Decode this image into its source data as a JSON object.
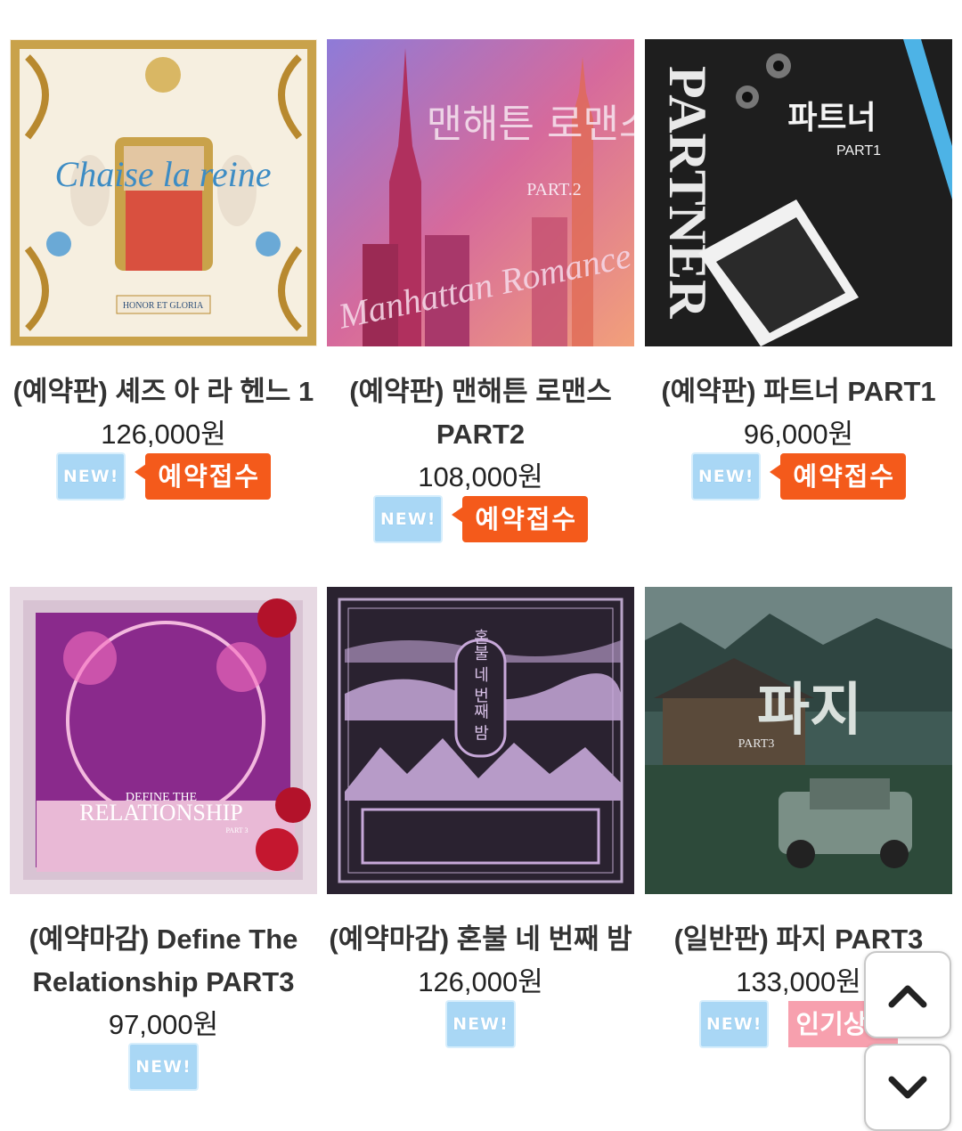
{
  "products": [
    {
      "title": "(예약판) 셰즈 아 라 헨느 1",
      "price": "126,000원",
      "badges": [
        "NEW!",
        "예약접수"
      ],
      "cover": "chaise-la-reine"
    },
    {
      "title": "(예약판) 맨해튼 로맨스 PART2",
      "price": "108,000원",
      "badges": [
        "NEW!",
        "예약접수"
      ],
      "cover": "manhattan-romance"
    },
    {
      "title": "(예약판) 파트너 PART1",
      "price": "96,000원",
      "badges": [
        "NEW!",
        "예약접수"
      ],
      "cover": "partner"
    },
    {
      "title": "(예약마감) Define The Relationship PART3",
      "price": "97,000원",
      "badges": [
        "NEW!"
      ],
      "cover": "define-relationship"
    },
    {
      "title": "(예약마감) 혼불 네 번째 밤",
      "price": "126,000원",
      "badges": [
        "NEW!"
      ],
      "cover": "honbul"
    },
    {
      "title": "(일반판) 파지 PART3",
      "price": "133,000원",
      "badges": [
        "NEW!",
        "인기상품"
      ],
      "cover": "paji"
    }
  ],
  "cover_text": {
    "chaise_script": "Chaise la reine",
    "chaise_banner": "HONOR ET GLORIA",
    "manhattan_ko": "맨해튼 로맨스",
    "manhattan_part": "PART.2",
    "manhattan_script": "Manhattan Romance",
    "partner_ko": "파트너",
    "partner_part": "PART1",
    "partner_en": "PARTNER",
    "dtr_line1": "DEFINE THE",
    "dtr_line2": "RELATIONSHIP",
    "dtr_part": "PART 3",
    "honbul_title": "혼불 네 번째 밤",
    "paji_title": "파지",
    "paji_part": "PART3"
  },
  "scroll": {
    "up_icon": "chevron-up-icon",
    "down_icon": "chevron-down-icon"
  }
}
